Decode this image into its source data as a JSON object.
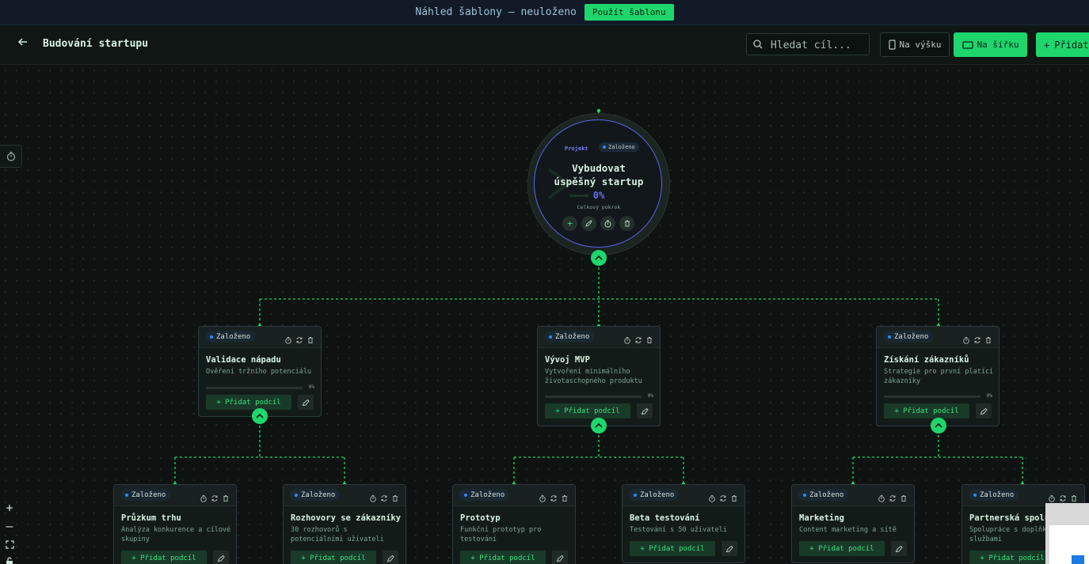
{
  "banner": {
    "text": "Náhled šablony — neuloženo",
    "button": "Použít šablonu"
  },
  "header": {
    "title": "Budování startupu",
    "search_placeholder": "Hledat cíl...",
    "portrait_label": "Na výšku",
    "landscape_label": "Na šířku",
    "add_label": "Přidat"
  },
  "root": {
    "type": "Projekt",
    "status": "Založeno",
    "title_line1": "Vybudovat",
    "title_line2": "úspěšný startup",
    "progress": "0%",
    "progress_label": "Celkový pokrok"
  },
  "goals": [
    {
      "status": "Založeno",
      "title": "Validace nápadu",
      "desc": "Ověření tržního potenciálu",
      "progress": "0%",
      "add": "+ Přidat podcíl"
    },
    {
      "status": "Založeno",
      "title": "Vývoj MVP",
      "desc": "Vytvoření minimálního životaschopného produktu",
      "progress": "0%",
      "add": "+ Přidat podcíl"
    },
    {
      "status": "Založeno",
      "title": "Získání zákazníků",
      "desc": "Strategie pro první platící zákazníky",
      "progress": "0%",
      "add": "+ Přidat podcíl"
    },
    {
      "status": "Založeno",
      "title": "Průzkum trhu",
      "desc": "Analýza konkurence a cílové skupiny",
      "add": "+ Přidat podcíl"
    },
    {
      "status": "Založeno",
      "title": "Rozhovory se zákazníky",
      "desc": "30 rozhovorů s potenciálními uživateli",
      "add": "+ Přidat podcíl"
    },
    {
      "status": "Založeno",
      "title": "Prototyp",
      "desc": "Funkční prototyp pro testování",
      "add": "+ Přidat podcíl"
    },
    {
      "status": "Založeno",
      "title": "Beta testování",
      "desc": "Testování s 50 uživateli",
      "add": "+ Přidat podcíl"
    },
    {
      "status": "Založeno",
      "title": "Marketing",
      "desc": "Content marketing a sítě",
      "add": "+ Přidat podcíl"
    },
    {
      "status": "Založeno",
      "title": "Partnerská spolupráce",
      "desc": "Spolupráce s doplňkovými službami",
      "add": "+ Přidat podcíl"
    }
  ],
  "zoom": {
    "in": "+",
    "out": "–"
  },
  "colors": {
    "accent": "#1ed66c",
    "root_ring": "#5c63e8",
    "status_dot": "#2f8cf0",
    "background": "#0e1311"
  }
}
